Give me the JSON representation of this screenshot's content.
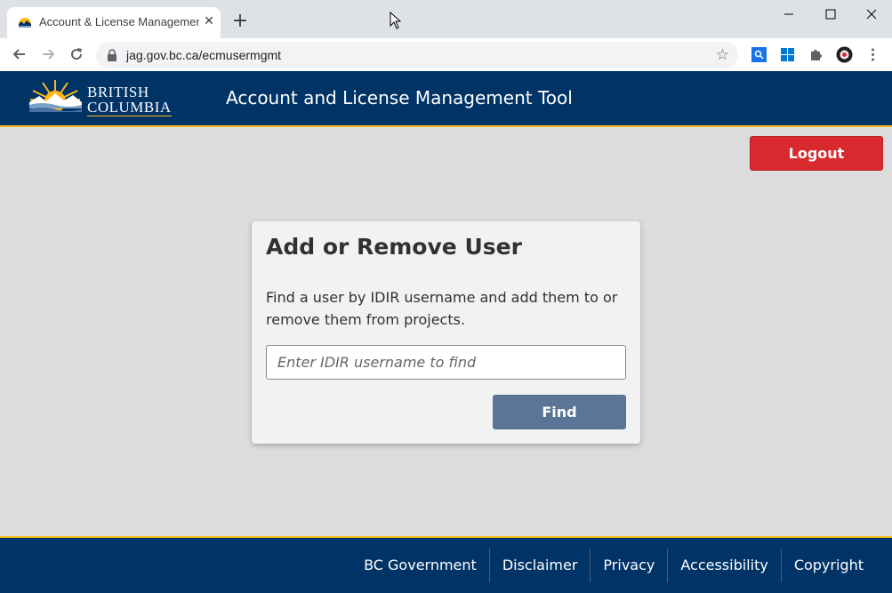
{
  "browser": {
    "tab_title": "Account & License Management",
    "tab_close": "✕",
    "new_tab": "+",
    "url": "jag.gov.bc.ca/ecmusermgmt"
  },
  "header": {
    "logo_line1": "BRITISH",
    "logo_line2": "COLUMBIA",
    "title": "Account and License Management Tool"
  },
  "logout_label": "Logout",
  "card": {
    "title": "Add or Remove User",
    "description": "Find a user by IDIR username and add them to or remove them from projects.",
    "input_placeholder": "Enter IDIR username to find",
    "input_value": "",
    "find_label": "Find"
  },
  "footer": {
    "links": [
      "BC Government",
      "Disclaimer",
      "Privacy",
      "Accessibility",
      "Copyright"
    ]
  },
  "colors": {
    "bc_blue": "#003366",
    "bc_gold": "#fcba19",
    "logout_red": "#d8292f",
    "find_button": "#5a7596"
  }
}
